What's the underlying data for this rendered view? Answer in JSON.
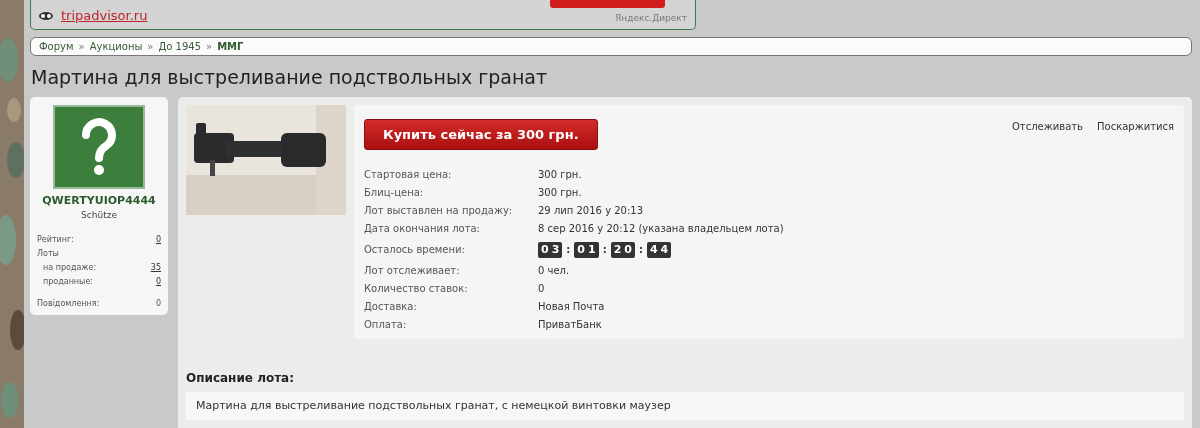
{
  "ad": {
    "link": "tripadvisor.ru",
    "source": "Яндекс.Директ"
  },
  "breadcrumb_separator": "»",
  "breadcrumb": [
    {
      "label": "Форум",
      "current": false
    },
    {
      "label": "Аукционы",
      "current": false
    },
    {
      "label": "До 1945",
      "current": false
    },
    {
      "label": "ММГ",
      "current": true
    }
  ],
  "title": "Мартина для выстреливание подствольных гранат",
  "user": {
    "name": "QWERTYUIOP4444",
    "rank": "Schütze",
    "stats": [
      {
        "label": "Рейтинг:",
        "value": "0",
        "link": true
      },
      {
        "label": "Лоты",
        "children": [
          {
            "label": "на продаже:",
            "value": "35",
            "link": true
          },
          {
            "label": "проданные:",
            "value": "0",
            "link": true
          }
        ]
      },
      {
        "label": "Повідомлення:",
        "value": "0",
        "link": false
      }
    ]
  },
  "lot": {
    "buy_button": "Купить сейчас за 300 грн.",
    "actions": [
      "Отслеживать",
      "Поскаржитися"
    ],
    "fields": [
      {
        "label": "Стартовая цена:",
        "value": "300 грн.",
        "kind": "text"
      },
      {
        "label": "Блиц-цена:",
        "value": "300 грн.",
        "kind": "text"
      },
      {
        "label": "Лот выставлен на продажу:",
        "value": "29 лип 2016 у 20:13",
        "kind": "text"
      },
      {
        "label": "Дата окончания лота:",
        "value": "8 сер 2016 у 20:12 (указана владельцем лота)",
        "kind": "text"
      },
      {
        "label": "Осталось времени:",
        "segments": [
          "03",
          "01",
          "20",
          "44"
        ],
        "separator": ":",
        "kind": "countdown"
      },
      {
        "label": "Лот отслеживает:",
        "value": "0 чел.",
        "kind": "text"
      },
      {
        "label": "Количество ставок:",
        "value": "0",
        "kind": "text"
      },
      {
        "label": "Доставка:",
        "value": "Новая Почта",
        "kind": "text"
      },
      {
        "label": "Оплата:",
        "value": "ПриватБанк",
        "kind": "text"
      }
    ]
  },
  "description": {
    "heading": "Описание лота:",
    "text": "Мартина для выстреливание подствольных гранат, с немецкой винтовки маузер"
  }
}
